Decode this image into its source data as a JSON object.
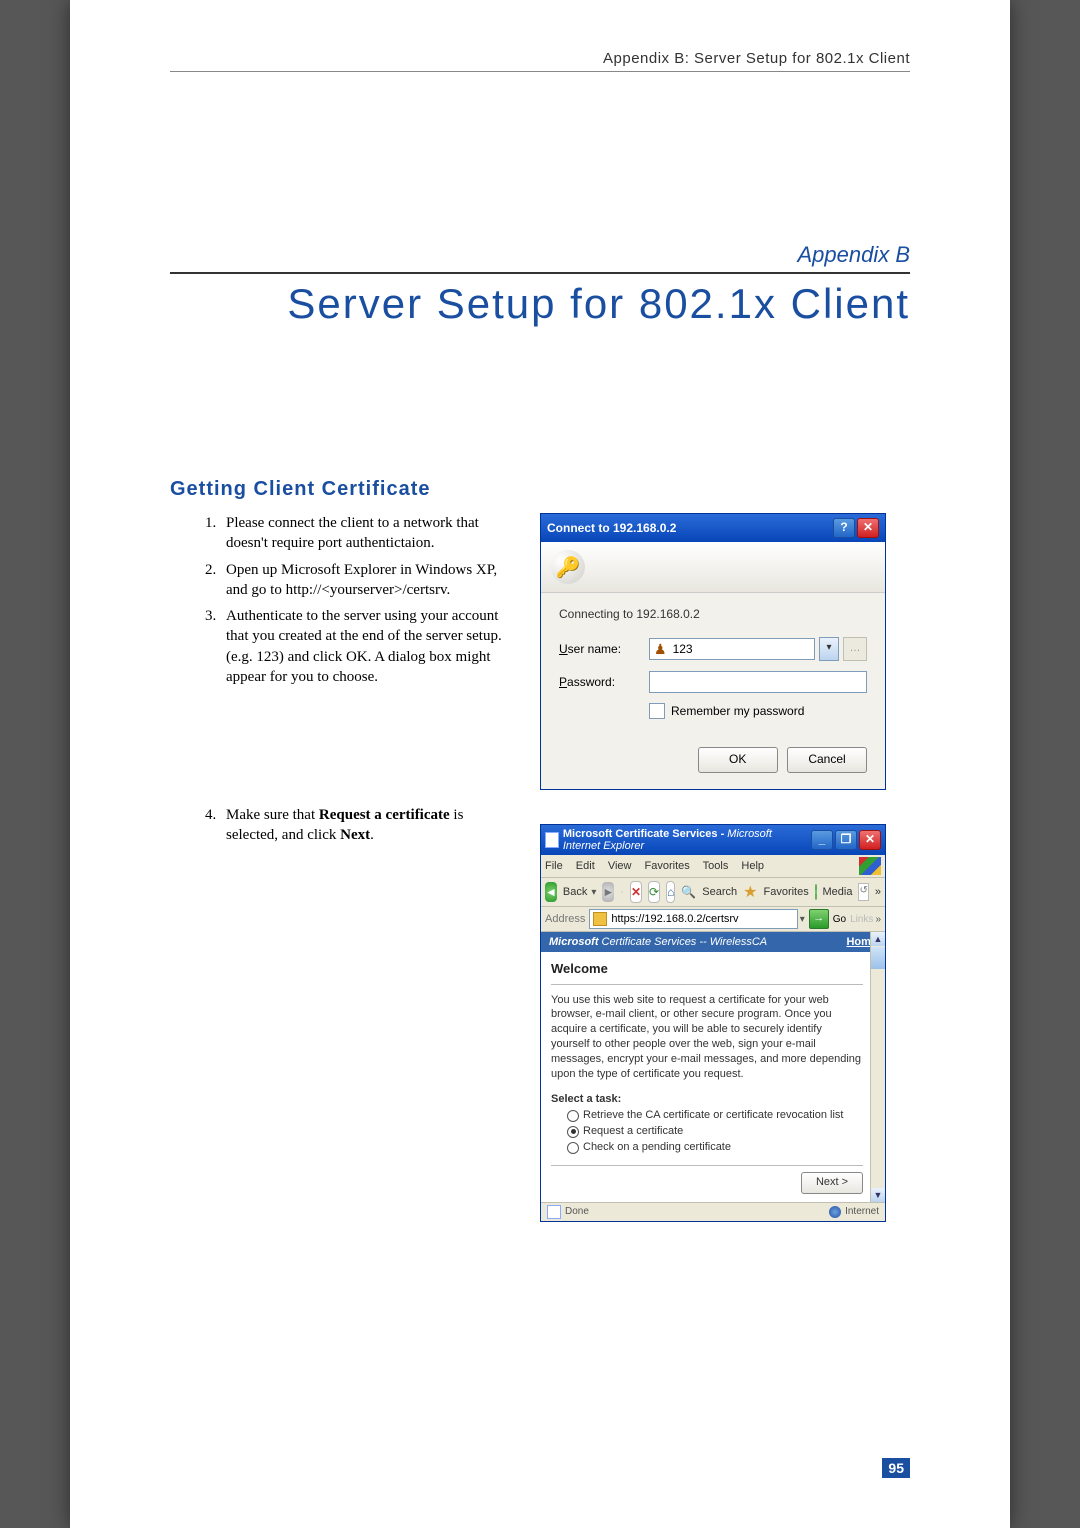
{
  "running_header": "Appendix B: Server Setup for 802.1x Client",
  "appendix_label": "Appendix B",
  "chapter_title": "Server Setup for 802.1x Client",
  "section_heading": "Getting Client Certificate",
  "steps": {
    "s1": "Please connect the client to a network that doesn't require port authentictaion.",
    "s2": "Open up Microsoft Explorer in Windows XP, and go to http://<yourserver>/certsrv.",
    "s3": "Authenticate to the server using your account that you created at the end of the server setup. (e.g. 123) and click OK. A dialog box might appear for you to choose.",
    "s4_pre": "Make sure that ",
    "s4_bold1": "Request a certificate",
    "s4_mid": " is selected, and click ",
    "s4_bold2": "Next",
    "s4_post": "."
  },
  "dialog1": {
    "title": "Connect to 192.168.0.2",
    "help_btn": "?",
    "close_btn": "✕",
    "connecting": "Connecting to 192.168.0.2",
    "username_label_u": "U",
    "username_label_rest": "ser name:",
    "password_label_u": "P",
    "password_label_rest": "assword:",
    "username_value": "123",
    "remember_u": "R",
    "remember_rest": "emember my password",
    "ok": "OK",
    "cancel": "Cancel"
  },
  "ie": {
    "title_prefix": "Microsoft Certificate Services - ",
    "title_suffix": "Microsoft Internet Explorer",
    "min": "_",
    "restore": "❐",
    "close": "✕",
    "menus": {
      "file": "File",
      "edit": "Edit",
      "view": "View",
      "favorites": "Favorites",
      "tools": "Tools",
      "help": "Help"
    },
    "back": "Back",
    "search": "Search",
    "favorites_btn": "Favorites",
    "media": "Media",
    "address_label": "Address",
    "address_value": "https://192.168.0.2/certsrv",
    "go": "Go",
    "links": "Links",
    "cs_brand_bold": "Microsoft",
    "cs_brand_rest": " Certificate Services  --  WirelessCA",
    "home": "Home",
    "welcome": "Welcome",
    "intro": "You use this web site to request a certificate for your web browser, e-mail client, or other secure program. Once you acquire a certificate, you will be able to securely identify yourself to other people over the web, sign your e-mail messages, encrypt your e-mail messages, and more depending upon the type of certificate you request.",
    "select_task": "Select a task:",
    "task1": "Retrieve the CA certificate or certificate revocation list",
    "task2": "Request a certificate",
    "task3": "Check on a pending certificate",
    "next": "Next >",
    "done": "Done",
    "internet": "Internet"
  },
  "page_number": "95"
}
